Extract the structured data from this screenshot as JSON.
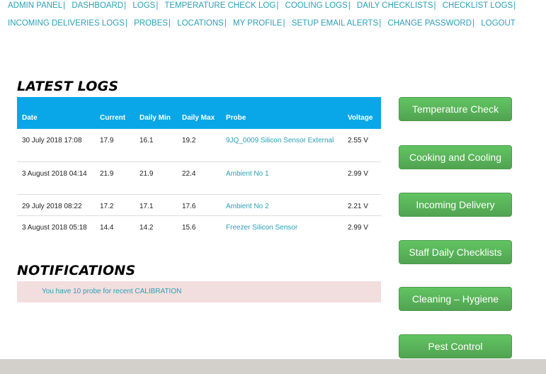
{
  "nav": {
    "row1": [
      "ADMIN PANEL",
      "DASHBOARD",
      "LOGS",
      "TEMPERATURE CHECK LOG",
      "COOLING LOGS",
      "DAILY CHECKLISTS",
      "CHECKLIST LOGS"
    ],
    "row2": [
      "INCOMING DELIVERIES LOGS",
      "PROBES",
      "LOCATIONS",
      "MY PROFILE",
      "SETUP EMAIL ALERTS",
      "CHANGE PASSWORD",
      "LOGOUT"
    ]
  },
  "logs": {
    "title": "LATEST LOGS",
    "headers": {
      "date": "Date",
      "current": "Current",
      "daily_min": "Daily Min",
      "daily_max": "Daily Max",
      "probe": "Probe",
      "voltage": "Voltage"
    },
    "rows": [
      {
        "date": "30 July 2018 17:08",
        "current": "17.9",
        "min": "16.1",
        "max": "19.2",
        "probe": "9JQ_0009 Silicon Sensor External",
        "voltage": "2.55 V"
      },
      {
        "date": "3 August 2018 04:14",
        "current": "21.9",
        "min": "21.9",
        "max": "22.4",
        "probe": "Ambient No 1",
        "voltage": "2.99 V"
      },
      {
        "date": "29 July 2018 08:22",
        "current": "17.2",
        "min": "17.1",
        "max": "17.6",
        "probe": "Ambient No 2",
        "voltage": "2.21 V"
      },
      {
        "date": "3 August 2018 05:18",
        "current": "14.4",
        "min": "14.2",
        "max": "15.6",
        "probe": "Freezer Silicon Sensor",
        "voltage": "2.99 V"
      }
    ]
  },
  "notifications": {
    "title": "NOTIFICATIONS",
    "message": "You have 10 probe for recent CALIBRATION"
  },
  "sidebar": {
    "buttons": [
      "Temperature Check",
      "Cooking and Cooling",
      "Incoming Delivery",
      "Staff Daily Checklists",
      "Cleaning – Hygiene",
      "Pest Control"
    ]
  },
  "colors": {
    "link": "#2aa0b8",
    "table_header": "#0aa7e8",
    "button_green": "#5cb85c",
    "notification_bg": "#f2dede",
    "footer": "#d3cfcb"
  }
}
